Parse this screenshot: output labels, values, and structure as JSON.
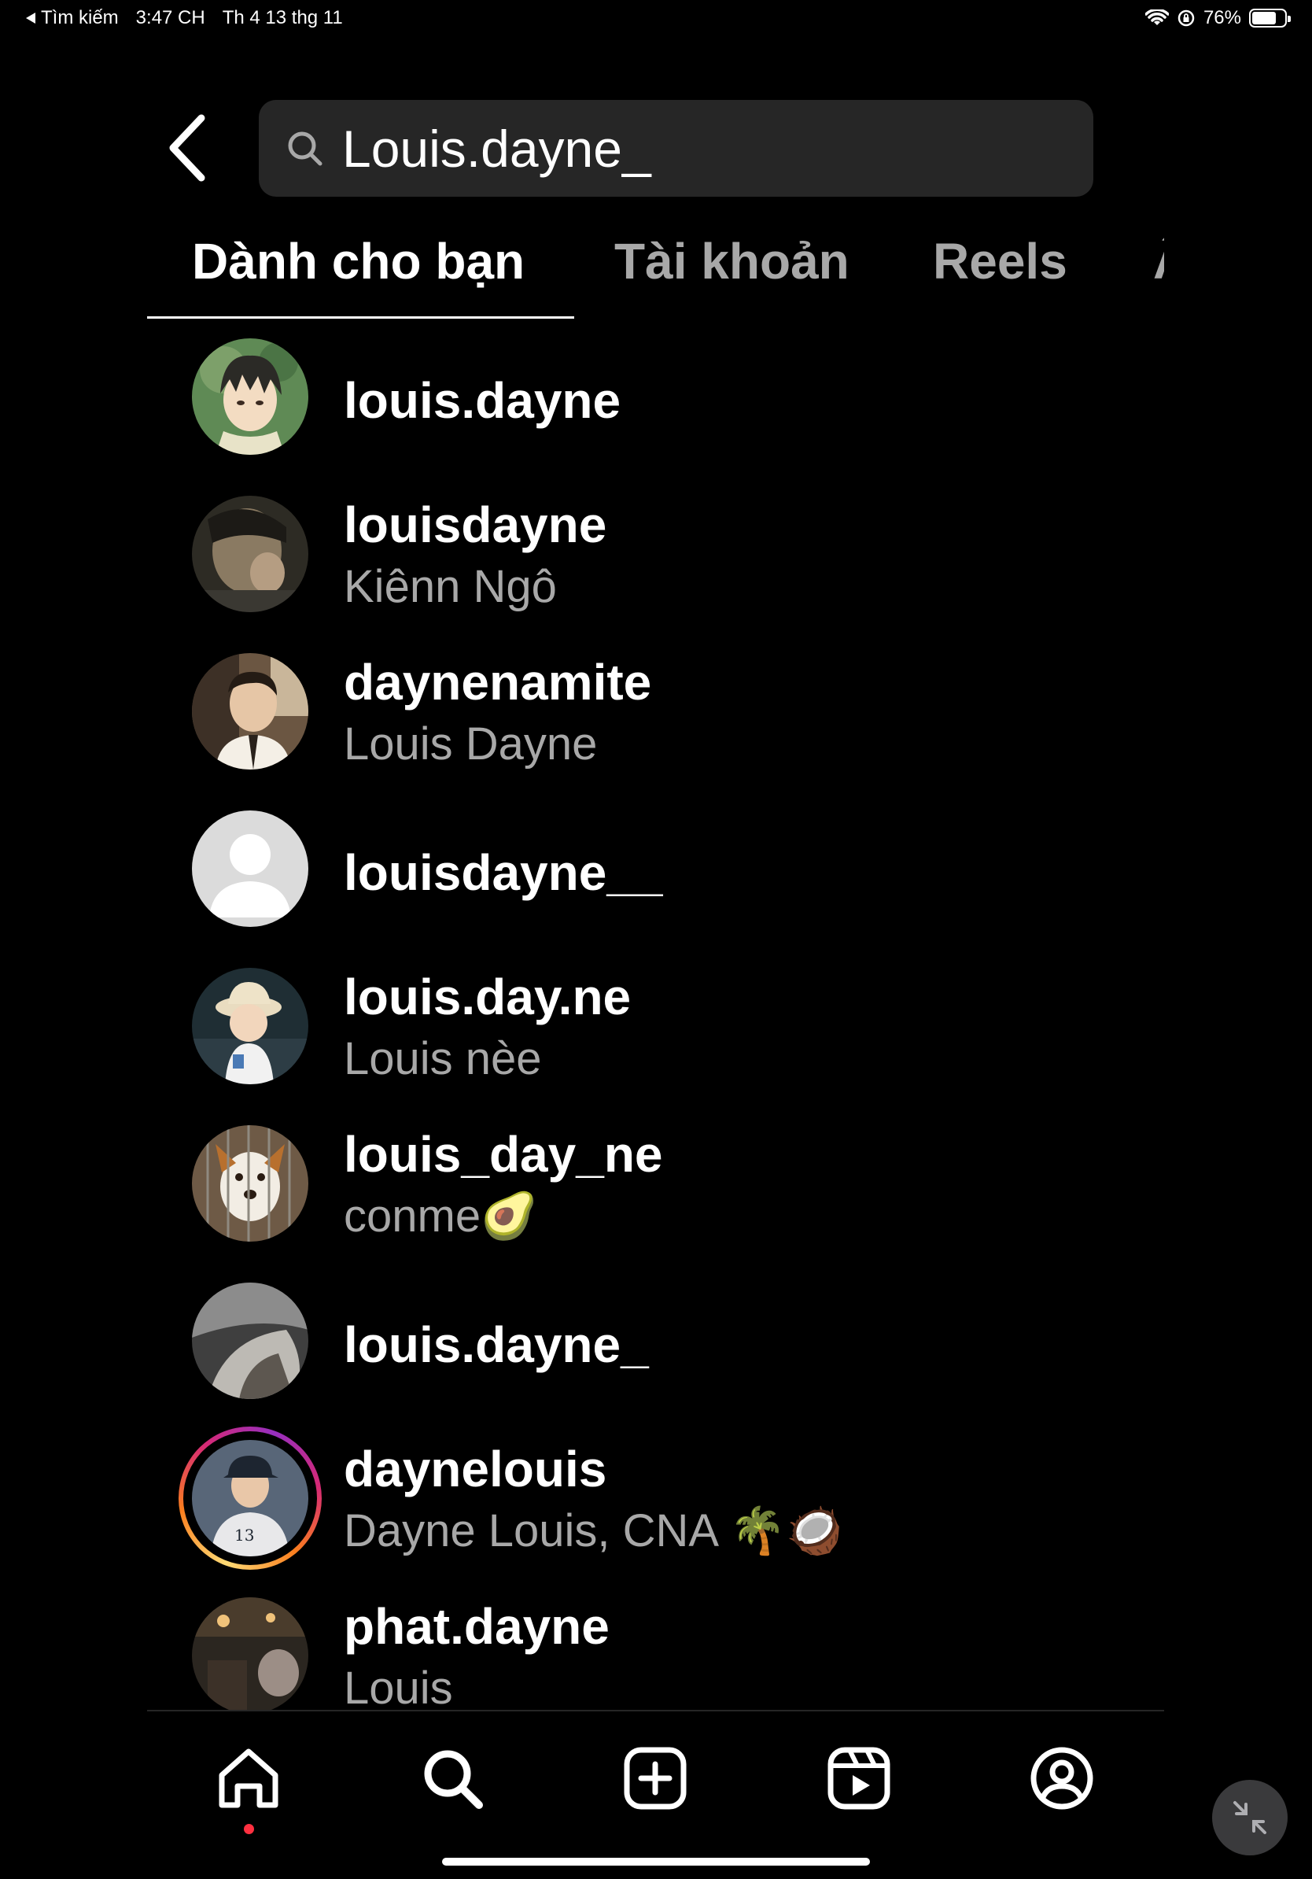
{
  "status_bar": {
    "back_app": "Tìm kiếm",
    "time": "3:47 CH",
    "date": "Th 4 13 thg 11",
    "battery": "76%",
    "battery_level": 0.76
  },
  "search": {
    "query": "Louis.dayne_"
  },
  "tabs": [
    {
      "label": "Dành cho bạn",
      "active": true
    },
    {
      "label": "Tài khoản",
      "active": false
    },
    {
      "label": "Reels",
      "active": false
    },
    {
      "label": "Âm thanh",
      "active": false
    }
  ],
  "results": [
    {
      "username": "louis.dayne",
      "fullname": ""
    },
    {
      "username": "louisdayne",
      "fullname": "Kiênn Ngô"
    },
    {
      "username": "daynenamite",
      "fullname": "Louis Dayne"
    },
    {
      "username": "louisdayne__",
      "fullname": ""
    },
    {
      "username": "louis.day.ne",
      "fullname": "Louis nèe"
    },
    {
      "username": "louis_day_ne",
      "fullname": "conme🥑"
    },
    {
      "username": "louis.dayne_",
      "fullname": ""
    },
    {
      "username": "daynelouis",
      "fullname": "Dayne Louis, CNA 🌴🥥",
      "has_story": true
    },
    {
      "username": "phat.dayne",
      "fullname": "Louis"
    }
  ],
  "bottom_nav": [
    "home-icon",
    "search-icon",
    "create-icon",
    "reels-icon",
    "profile-icon"
  ],
  "colors": {
    "background": "#000000",
    "search_bg": "#262626",
    "secondary_text": "#a8a8a8",
    "notification_dot": "#ff3040"
  }
}
